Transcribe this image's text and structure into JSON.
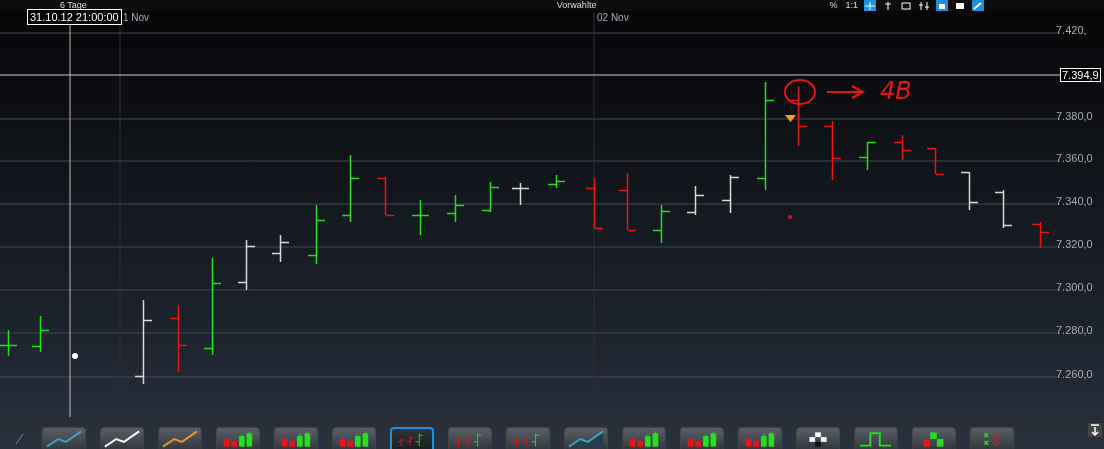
{
  "top_bar": {
    "range_label": "6 Tage",
    "preset_label": "Vorwahlte",
    "tools": [
      {
        "kind": "percent",
        "label": "%",
        "selected": false
      },
      {
        "kind": "scale",
        "label": "1:1",
        "selected": false
      },
      {
        "kind": "crosshair",
        "selected": true
      },
      {
        "kind": "pin",
        "selected": false
      },
      {
        "kind": "window",
        "selected": false
      },
      {
        "kind": "filter",
        "selected": false
      },
      {
        "kind": "box",
        "selected": true
      },
      {
        "kind": "square",
        "selected": false
      },
      {
        "kind": "pen",
        "selected": true
      }
    ]
  },
  "chart": {
    "crosshair_time": "31.10.12 21:00:00",
    "x_labels": [
      "1 Nov",
      "02 Nov"
    ],
    "y_labels": [
      "7.420,",
      "7.380,0",
      "7.360,0",
      "7.340,0",
      "7.320,0",
      "7.300,0",
      "7.280,0",
      "7.260,0"
    ],
    "last_price": "7.394,9",
    "note": "4B"
  },
  "chart_types": [
    {
      "kind": "line",
      "color": "#3aa6b8",
      "selected": false
    },
    {
      "kind": "line",
      "color": "#ffffff",
      "selected": false
    },
    {
      "kind": "line",
      "color": "#e89a2a",
      "selected": false
    },
    {
      "kind": "candles",
      "selected": false
    },
    {
      "kind": "candles",
      "selected": false
    },
    {
      "kind": "candles",
      "selected": false
    },
    {
      "kind": "ohlc",
      "selected": true
    },
    {
      "kind": "ohlc",
      "selected": false
    },
    {
      "kind": "ohlc",
      "selected": false
    },
    {
      "kind": "mountain",
      "color": "#3aa6b8",
      "selected": false
    },
    {
      "kind": "candles",
      "selected": false
    },
    {
      "kind": "candles",
      "selected": false
    },
    {
      "kind": "candles",
      "selected": false
    },
    {
      "kind": "blocks",
      "selected": false
    },
    {
      "kind": "step",
      "selected": false
    },
    {
      "kind": "kagi",
      "selected": false
    },
    {
      "kind": "xo",
      "selected": false
    }
  ]
}
